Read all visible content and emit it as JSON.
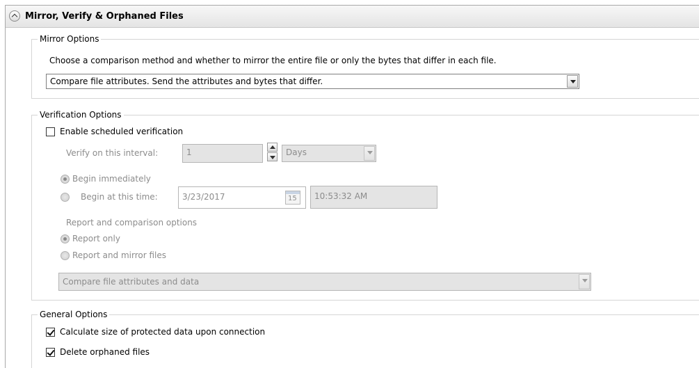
{
  "section": {
    "title": "Mirror, Verify & Orphaned Files"
  },
  "mirror_options": {
    "legend": "Mirror Options",
    "description": "Choose a comparison method and whether to mirror the entire file or only the bytes that differ in each file.",
    "method_selected": "Compare file attributes. Send the attributes and bytes that differ."
  },
  "verification_options": {
    "legend": "Verification Options",
    "enable_label": "Enable scheduled verification",
    "enable_checked": false,
    "interval_label": "Verify on this interval:",
    "interval_value": "1",
    "interval_unit": "Days",
    "begin_immediately_label": "Begin immediately",
    "begin_at_label": "Begin at this time:",
    "begin_date": "3/23/2017",
    "calendar_day": "15",
    "begin_time": "10:53:32 AM",
    "report_heading": "Report and comparison options",
    "report_only_label": "Report only",
    "report_mirror_label": "Report and mirror files",
    "compare_selected": "Compare file attributes and data"
  },
  "general_options": {
    "legend": "General Options",
    "calc_size_label": "Calculate size of protected data upon connection",
    "calc_size_checked": true,
    "delete_orphans_label": "Delete orphaned files",
    "delete_orphans_checked": true
  }
}
